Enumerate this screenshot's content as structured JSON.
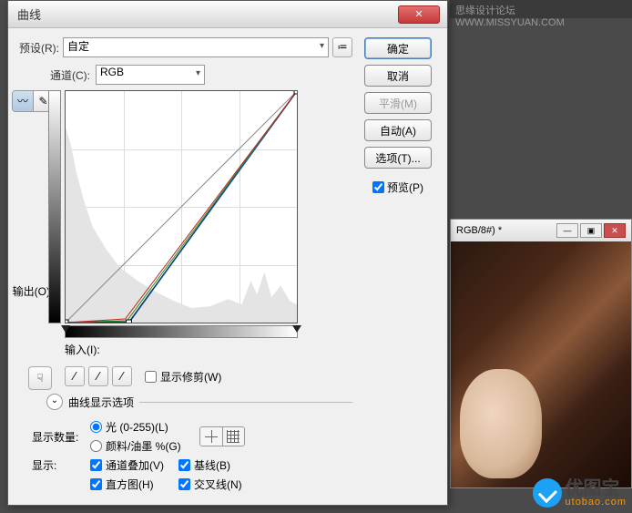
{
  "bg_header": "思缘设计论坛 WWW.MISSYUAN.COM",
  "bg_window_title": "RGB/8#) *",
  "watermark": {
    "cn": "优图宝",
    "en": "utobao.com"
  },
  "dialog": {
    "title": "曲线",
    "preset_label": "预设(R):",
    "preset_value": "自定",
    "channel_label": "通道(C):",
    "channel_value": "RGB",
    "output_label": "输出(O):",
    "input_label": "输入(I):",
    "show_clipping": "显示修剪(W)",
    "disclosure": "曲线显示选项",
    "show_amount_label": "显示数量:",
    "radio_light": "光 (0-255)(L)",
    "radio_pigment": "颜料/油墨 %(G)",
    "show_label": "显示:",
    "check_overlay": "通道叠加(V)",
    "check_baseline": "基线(B)",
    "check_histogram": "直方图(H)",
    "check_intersection": "交叉线(N)"
  },
  "buttons": {
    "ok": "确定",
    "cancel": "取消",
    "smooth": "平滑(M)",
    "auto": "自动(A)",
    "options": "选项(T)...",
    "preview": "预览(P)"
  },
  "chart_data": {
    "type": "line",
    "title": "Curves",
    "xlabel": "输入",
    "ylabel": "输出",
    "xlim": [
      0,
      255
    ],
    "ylim": [
      0,
      255
    ],
    "composite_points": [
      [
        0,
        0
      ],
      [
        70,
        0
      ],
      [
        255,
        255
      ]
    ],
    "baseline": [
      [
        0,
        0
      ],
      [
        255,
        255
      ]
    ],
    "grid": true
  }
}
